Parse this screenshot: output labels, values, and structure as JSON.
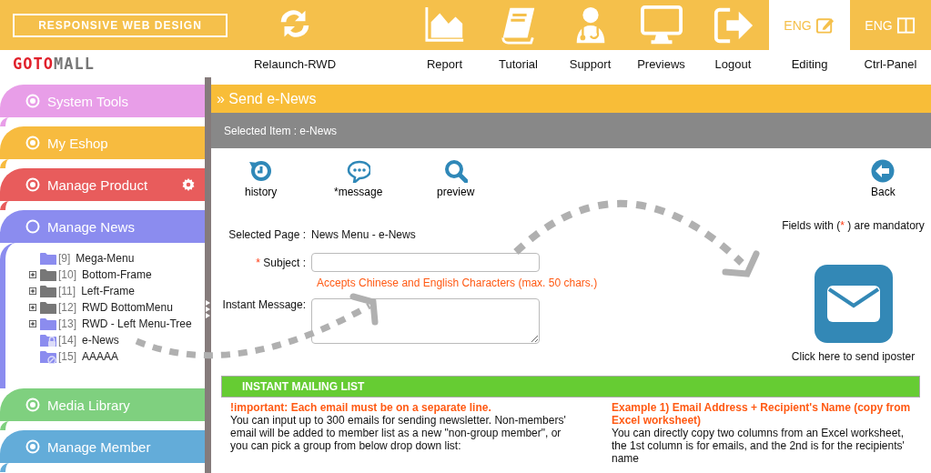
{
  "header": {
    "tagline": "RESPONSIVE WEB DESIGN",
    "logo": [
      "GOTO",
      "MALL"
    ],
    "nav": [
      {
        "label": "Relaunch-RWD",
        "selected": false
      },
      {
        "label": "Report",
        "selected": false
      },
      {
        "label": "Tutorial",
        "selected": false
      },
      {
        "label": "Support",
        "selected": false
      },
      {
        "label": "Previews",
        "selected": false
      },
      {
        "label": "Logout",
        "selected": false
      },
      {
        "label": "Editing",
        "badge": "ENG",
        "selected": true
      },
      {
        "label": "Ctrl-Panel",
        "badge": "ENG",
        "selected": false
      }
    ]
  },
  "sidebar": {
    "sections": [
      {
        "label": "System Tools",
        "color": "#e89ee8",
        "expanded": false,
        "settings": false
      },
      {
        "label": "My Eshop",
        "color": "#f7bb3f",
        "expanded": false,
        "settings": false
      },
      {
        "label": "Manage Product",
        "color": "#e85c5c",
        "expanded": false,
        "settings": true
      },
      {
        "label": "Manage News",
        "color": "#8b8cef",
        "expanded": true,
        "settings": false,
        "tree": [
          {
            "number": "[9]",
            "label": "Mega-Menu",
            "kind": "folder",
            "color": "#8b8cef",
            "expandable": false
          },
          {
            "number": "[10]",
            "label": "Bottom-Frame",
            "kind": "folder",
            "color": "#777777",
            "expandable": true
          },
          {
            "number": "[11]",
            "label": "Left-Frame",
            "kind": "folder",
            "color": "#777777",
            "expandable": true
          },
          {
            "number": "[12]",
            "label": "RWD BottomMenu",
            "kind": "folder",
            "color": "#777777",
            "expandable": true
          },
          {
            "number": "[13]",
            "label": "RWD - Left Menu-Tree",
            "kind": "folder",
            "color": "#8b8cef",
            "expandable": true
          },
          {
            "number": "[14]",
            "label": "e-News",
            "kind": "locked",
            "color": "#8b8cef",
            "expandable": false
          },
          {
            "number": "[15]",
            "label": "AAAAA",
            "kind": "blocked",
            "color": "#8b8cef",
            "expandable": false
          }
        ]
      },
      {
        "label": "Media Library",
        "color": "#7fd07f",
        "expanded": false,
        "settings": false
      },
      {
        "label": "Manage Member",
        "color": "#63acd9",
        "expanded": false,
        "settings": false
      }
    ]
  },
  "main": {
    "title": "» Send e-News",
    "selected_item": "Selected Item : e-News",
    "toolbar": [
      {
        "label": "history",
        "kind": "history"
      },
      {
        "label": "*message",
        "kind": "message"
      },
      {
        "label": "preview",
        "kind": "preview"
      },
      {
        "label": "Back",
        "kind": "back"
      }
    ],
    "selected_page": {
      "label": "Selected Page :",
      "value": "News Menu - e-News"
    },
    "fields": [
      {
        "label": "Subject :",
        "required_mark": "*",
        "kind": "input",
        "hint": "Accepts Chinese and English Characters (max. 50 chars.)"
      },
      {
        "label": "Instant Message:",
        "kind": "textarea"
      }
    ],
    "mandatory_note": {
      "before": "Fields with (",
      "mark": "*",
      "after": " ) are mandatory"
    },
    "send_caption": "Click here to send iposter",
    "mailing_list": {
      "title": "INSTANT MAILING LIST",
      "columns": [
        {
          "heading": "!important: Each email must be on a separate line.",
          "text": "You can input up to 300 emails for sending newsletter. Non-members' email will be added to member list as a new \"non-group member\", or you can pick a group from below drop down list:"
        },
        {
          "heading": "Example 1) Email Address + Recipient's Name (copy from Excel worksheet)",
          "text": "You can directly copy two columns from an Excel worksheet, the 1st column is for emails, and the 2nd is for the recipients' name"
        }
      ]
    }
  }
}
